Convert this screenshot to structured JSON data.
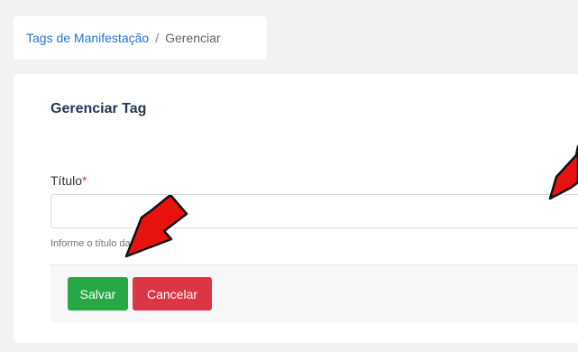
{
  "breadcrumb": {
    "parent_label": "Tags de Manifestação",
    "separator": "/",
    "current_label": "Gerenciar"
  },
  "form": {
    "title": "Gerenciar Tag",
    "field_label": "Título",
    "required_mark": "*",
    "field_value": "",
    "help_text": "Informe o título da tag"
  },
  "actions": {
    "save_label": "Salvar",
    "cancel_label": "Cancelar"
  },
  "colors": {
    "link": "#1f74d8",
    "save": "#28a745",
    "cancel": "#dc3545",
    "arrow": "#e8130f"
  },
  "annotations": {
    "arrow_icon": "red-arrow-icon"
  }
}
